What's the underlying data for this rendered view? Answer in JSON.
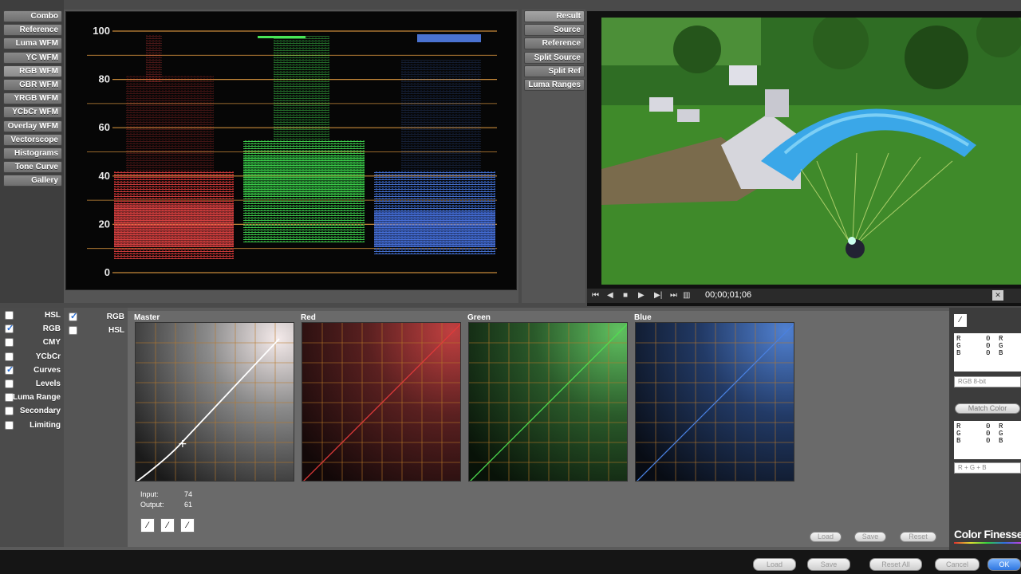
{
  "scope_tabs": [
    "Combo",
    "Reference",
    "Luma WFM",
    "YC WFM",
    "RGB WFM",
    "GBR WFM",
    "YRGB WFM",
    "YCbCr WFM",
    "Overlay WFM",
    "Vectorscope",
    "Histograms",
    "Tone Curve",
    "Gallery"
  ],
  "scope_active_index": 4,
  "waveform": {
    "axis_labels": [
      "100",
      "80",
      "60",
      "40",
      "20",
      "0"
    ],
    "channel_colors": [
      "#e03030",
      "#30d040",
      "#3070e0"
    ]
  },
  "viewer_tabs": [
    "Result",
    "Source",
    "Reference",
    "Split Source",
    "Split Ref",
    "Luma Ranges"
  ],
  "viewer_active_index": 0,
  "timecode": "00;00;01;06",
  "correction_tabs": [
    {
      "label": "HSL",
      "checked": false
    },
    {
      "label": "RGB",
      "checked": true
    },
    {
      "label": "CMY",
      "checked": false
    },
    {
      "label": "YCbCr",
      "checked": false
    },
    {
      "label": "Curves",
      "checked": true
    },
    {
      "label": "Levels",
      "checked": false
    },
    {
      "label": "Luma Range",
      "checked": false
    },
    {
      "label": "Secondary",
      "checked": false
    },
    {
      "label": "Limiting",
      "checked": false
    }
  ],
  "curves_sub_tabs": [
    {
      "label": "RGB",
      "checked": true
    },
    {
      "label": "HSL",
      "checked": false
    }
  ],
  "curves": [
    {
      "label": "Master",
      "color": "#ffffff"
    },
    {
      "label": "Red",
      "color": "#e03a3a"
    },
    {
      "label": "Green",
      "color": "#50e050"
    },
    {
      "label": "Blue",
      "color": "#4a80e0"
    }
  ],
  "readout": {
    "input_label": "Input:",
    "input_value": "74",
    "output_label": "Output:",
    "output_value": "61"
  },
  "curve_buttons": {
    "load": "Load",
    "save": "Save",
    "reset": "Reset"
  },
  "right_panel": {
    "rgb_rows": [
      "R",
      "G",
      "B"
    ],
    "rgb_values": [
      "0",
      "0",
      "0"
    ],
    "bitdepth": "RGB 8-bit",
    "match_color": "Match Color",
    "formula": "R + G + B",
    "brand": "Color Finesse"
  },
  "bottom_buttons": {
    "load": "Load",
    "save": "Save",
    "reset_all": "Reset All",
    "cancel": "Cancel",
    "ok": "OK"
  }
}
